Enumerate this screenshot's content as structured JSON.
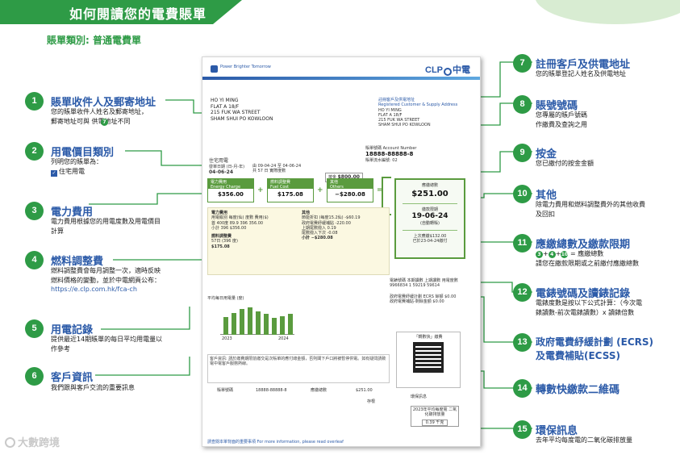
{
  "banner": {
    "title": "如何閱讀您的電費賬單"
  },
  "subtitle": "賬單類別: 普通電費單",
  "bill": {
    "company": "Power Brighter Tomorrow",
    "logo_text": "CLP",
    "logo_cn": "中電",
    "recipient": [
      "HO YI MING",
      "FLAT A 18/F",
      "215 FUK WA STREET",
      "SHAM SHUI PO KOWLOON"
    ],
    "reg_title": "註冊客戶及供電地址",
    "reg_title_en": "Registered Customer & Supply Address",
    "reg_lines": [
      "HO YI MING",
      "FLAT A 18/F",
      "215 FUK WA STREET",
      "SHAM SHUI PO KOWLOON"
    ],
    "account_label": "賬單號碼 Account Number",
    "account_number": "18888-88888-8",
    "account_sub": "賬單流水編號: 02",
    "category": "住宅用電",
    "category_sub": "發單日期 (日-月-年)",
    "issue_date": "04-06-24",
    "period": "由 09-04-24 至 04-06-24",
    "period_days": "共 57 日 實際度數",
    "deposit_label": "按金",
    "deposit": "$800.00",
    "cards": [
      {
        "cn": "電力費用",
        "en": "Energy Charge",
        "amount": "$356.00"
      },
      {
        "cn": "燃料調整費",
        "en": "Fuel Cost Adjustment",
        "amount": "$175.08"
      },
      {
        "cn": "其他",
        "en": "Others",
        "amount": "−$280.08"
      }
    ],
    "ops": [
      "+",
      "+",
      "="
    ],
    "total_label": "應繳總數",
    "total": "$251.00",
    "due_label": "繳款限期",
    "due_date": "19-06-24",
    "due_note": "(自動轉賬)",
    "last_paid": "上次應繳$132.00",
    "last_paid2": "已於23-04-24繳付",
    "detail": {
      "c1": [
        "電力費用",
        "用電級別    每度(仙)    度數        費用($)",
        "首 400度      89.9        396          356.00",
        "小計                               396          $356.00",
        "燃料調整費",
        "57日 (396 度)",
        "                                                    $175.08"
      ],
      "c2": [
        "其他",
        "節能折扣 (每度15.2仙)            -$60.19",
        "政府電費紓緩補貼                   -220.00",
        "上期尾數撥入                             0.19",
        "尾數撥入下次                            -0.08",
        "小計                                        −$280.08"
      ]
    },
    "chart_label": "平均每日用電量 (度)",
    "chart_years": [
      "2023",
      "2024"
    ],
    "chart_values": [
      6.0,
      7.2,
      8.5,
      9.1,
      7.8,
      6.9,
      5.5,
      6.2,
      7.0
    ],
    "meter_headers": "電錶號碼    本期讀數    上期讀數    用電度數",
    "meter_values": "9966834      1           59219      59614",
    "ecrs_lines": [
      "政府電費紓緩計劃 ECRS 餘額 $0.00",
      "政府電費補貼-剩餘金額  $0.00"
    ],
    "customer_info": "客戶資訊: 請於繳費期限前繳交是次賬單的應付總金額，否則閣下戶口將被暫停供電。如有疑問請致電中電客戶服務熱線。",
    "qr_title": "「轉數快」繳費",
    "footer_labels": [
      "賬單號碼",
      "18888-88888-8",
      "應繳總數",
      "$251.00",
      "存根"
    ],
    "env_header": "環保訊息",
    "env_line": "2023年平均每度電 二氧化碳排放量",
    "env_value": "0.39 千克",
    "bill_foot": "請查閱本單背面的重要事項 For more information, please read overleaf"
  },
  "callouts": [
    {
      "num": "1",
      "title": "賬單收件人及郵寄地址",
      "desc": [
        "您的賬單收件人姓名及郵寄地址，",
        "郵寄地址可與     供電地址不同"
      ],
      "ref": "7"
    },
    {
      "num": "2",
      "title": "用電價目類別",
      "desc": [
        "列明您的賬單為：",
        "住宅用電"
      ]
    },
    {
      "num": "3",
      "title": "電力費用",
      "desc": [
        "電力費用根據您的用電度數及用電價目",
        "計算"
      ]
    },
    {
      "num": "4",
      "title": "燃料調整費",
      "desc": [
        "燃料調整費會每月調整一次，適時反映",
        "燃料價格的變動，並於中電網頁公布：",
        "https://e.clp.com.hk/fca-ch"
      ]
    },
    {
      "num": "5",
      "title": "用電記錄",
      "desc": [
        "提供最近14期賬單的每日平均用電量以",
        "作參考"
      ]
    },
    {
      "num": "6",
      "title": "客戶資訊",
      "desc": [
        "我們跟與客戶交流的重要訊息"
      ]
    },
    {
      "num": "7",
      "title": "註冊客戶及供電地址",
      "desc": [
        "您的賬單登記人姓名及供電地址"
      ]
    },
    {
      "num": "8",
      "title": "賬號號碼",
      "desc": [
        "您專屬的賬戶號碼",
        "作繳費及查詢之用"
      ]
    },
    {
      "num": "9",
      "title": "按金",
      "desc": [
        "您已繳付的按金金額"
      ]
    },
    {
      "num": "10",
      "title": "其他",
      "desc": [
        "除電力費用和燃料調整費外的其他收費",
        "及回扣"
      ]
    },
    {
      "num": "11",
      "title": "應繳總數及繳款限期",
      "desc": [
        "         = 應繳總數",
        "請您在繳款限期或之前繳付應繳總數"
      ],
      "formula": [
        "3",
        "4",
        "10"
      ]
    },
    {
      "num": "12",
      "title": "電錶號碼及讀錶記錄",
      "desc": [
        "電錶度數是按以下公式計算：（今次電",
        "錶讀數-前次電錶讀數）x 讀錶倍數"
      ]
    },
    {
      "num": "13",
      "title": "政府電費紓緩計劃 (ECRS)",
      "title2": "及電費補貼(ECSS)",
      "desc": []
    },
    {
      "num": "14",
      "title": "轉數快繳款二維碼",
      "desc": []
    },
    {
      "num": "15",
      "title": "環保訊息",
      "desc": [
        "去年平均每度電的二氧化碳排放量"
      ]
    }
  ],
  "watermark": "大數跨境",
  "colors": {
    "green": "#2e9b46",
    "blue": "#2b5aa8",
    "panel": "#fbf8e1"
  }
}
